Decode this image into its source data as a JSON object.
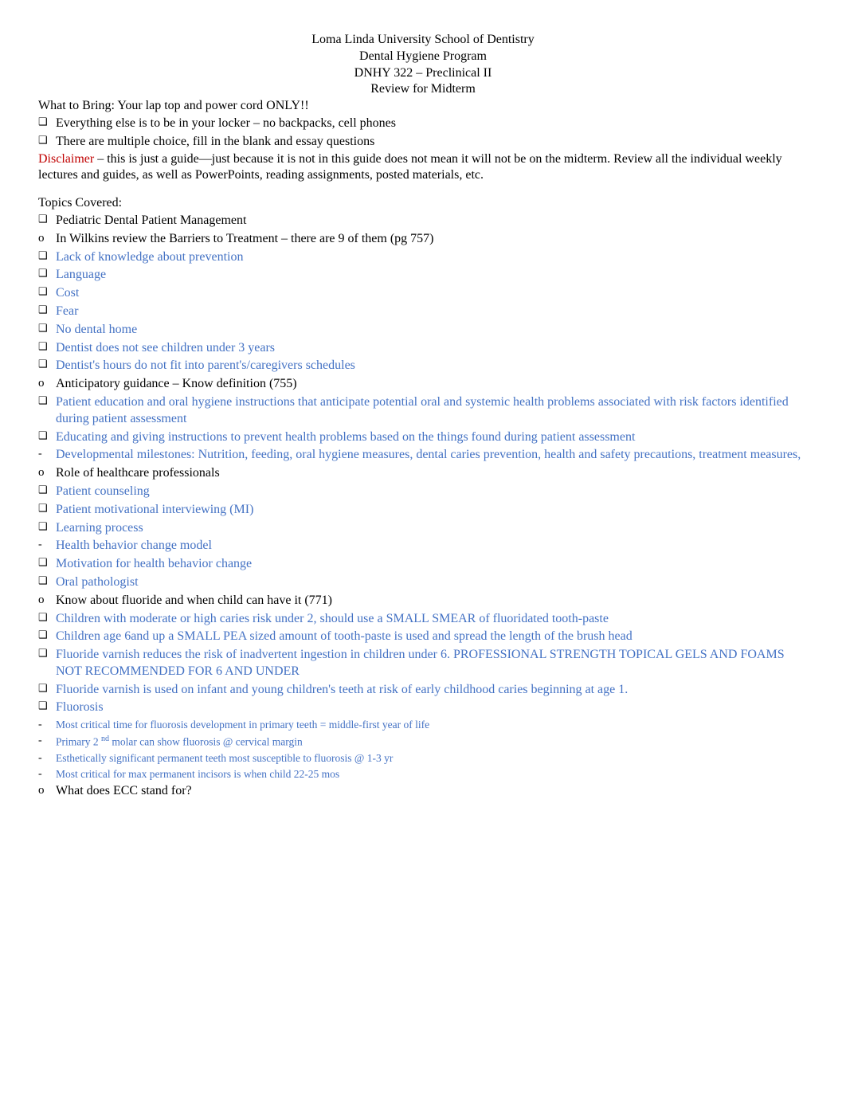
{
  "header": {
    "l1": "Loma Linda University School of Dentistry",
    "l2": "Dental Hygiene Program",
    "l3": "DNHY 322 – Preclinical II",
    "l4": "Review for Midterm"
  },
  "bring": {
    "label": "What to Bring:  Your lap top and power cord ONLY!!",
    "b1": "Everything else is to be in your locker – no backpacks, cell phones",
    "b2": "There are multiple choice, fill in the blank and essay questions"
  },
  "disclaimer": {
    "word": "Disclaimer",
    "rest": " – this is just a guide—just because it is not in this guide does not mean it will not be on the midterm.    Review all the individual weekly lectures and guides, as well as PowerPoints, reading assignments, posted materials, etc."
  },
  "topics_label": "Topics Covered:",
  "pediatric": {
    "title": "Pediatric Dental Patient Management",
    "barriers": {
      "title": "In Wilkins review the Barriers to Treatment – there are 9 of them (pg 757)",
      "items": [
        "Lack of knowledge about prevention",
        "Language",
        "Cost",
        "Fear",
        "No dental home",
        "Dentist does not see children under 3 years",
        "Dentist's hours do not fit into parent's/caregivers schedules"
      ]
    },
    "anticipatory": {
      "title": "Anticipatory guidance – Know definition (755)",
      "items": [
        "Patient education and oral hygiene instructions that anticipate potential oral and systemic health problems associated with risk factors identified during patient assessment",
        "Educating and giving instructions to prevent health problems based on the things found during patient assessment"
      ],
      "sub": "Developmental milestones: Nutrition, feeding, oral hygiene measures, dental caries prevention, health and safety precautions, treatment measures,"
    },
    "role": {
      "title": "Role of healthcare professionals",
      "items": [
        "Patient counseling",
        "Patient motivational interviewing (MI)",
        "Learning process"
      ],
      "sub": "Health behavior change model",
      "items2": [
        "Motivation for health behavior change",
        "Oral pathologist"
      ]
    },
    "fluoride": {
      "title": "Know about fluoride and when child can have it (771)",
      "items": [
        "Children with moderate or high caries risk under 2, should use a SMALL SMEAR of fluoridated tooth-paste",
        "Children age 6and up a SMALL PEA sized amount of tooth-paste is used and spread the length of the brush head",
        "Fluoride varnish reduces the risk of inadvertent ingestion in children under 6. PROFESSIONAL STRENGTH TOPICAL GELS AND FOAMS NOT RECOMMENDED FOR 6 AND UNDER",
        "Fluoride varnish is used on infant and young children's teeth at risk of early childhood caries beginning at age 1.",
        "Fluorosis"
      ],
      "fluorosis_sub": {
        "a": "Most critical time for fluorosis development in primary teeth = middle-first year of life",
        "b_pre": "Primary 2 ",
        "b_sup": "nd",
        "b_post": " molar can show fluorosis @ cervical margin",
        "c": "Esthetically significant permanent teeth most susceptible to fluorosis @ 1-3 yr",
        "d": "Most critical for max permanent incisors is when child 22-25 mos"
      }
    },
    "ecc": {
      "title": "What does ECC stand for?"
    }
  }
}
